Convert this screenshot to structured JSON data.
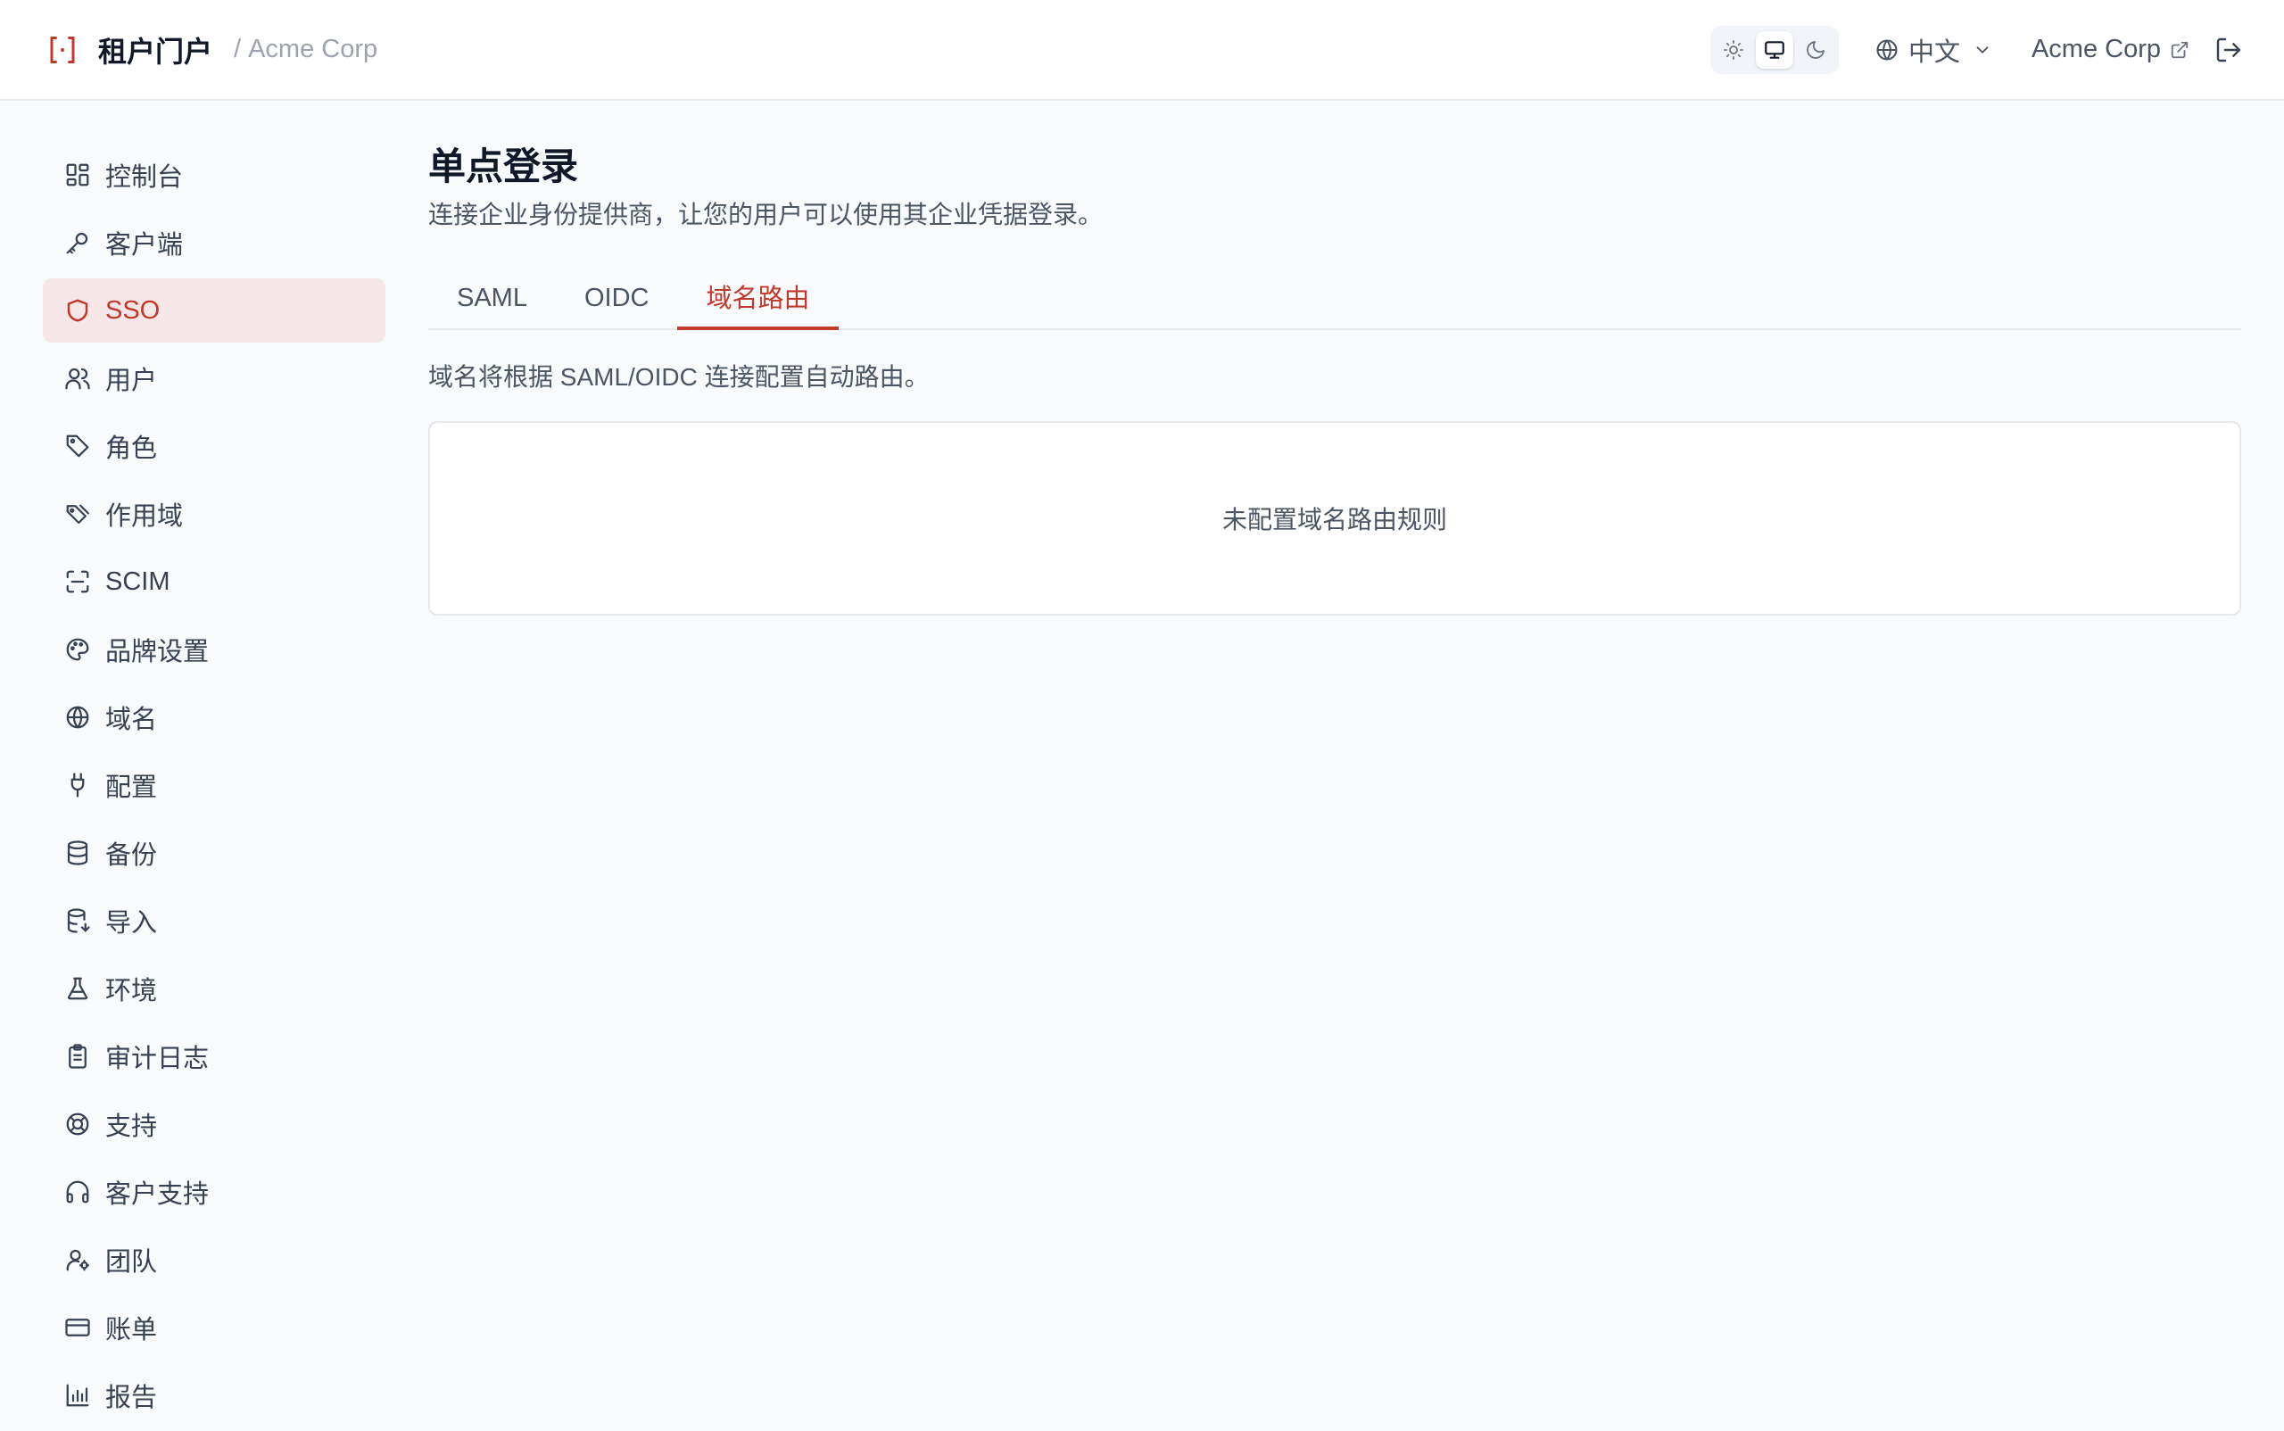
{
  "header": {
    "app_name": "租户门户",
    "separator": "/",
    "tenant": "Acme Corp",
    "theme_options": [
      "light",
      "system",
      "dark"
    ],
    "theme_selected": "system",
    "language": "中文",
    "tenant_link": "Acme Corp",
    "accent_color": "#c0392b"
  },
  "sidebar": {
    "items": [
      {
        "label": "控制台",
        "icon": "dashboard-icon"
      },
      {
        "label": "客户端",
        "icon": "key-icon"
      },
      {
        "label": "SSO",
        "icon": "shield-icon",
        "active": true
      },
      {
        "label": "用户",
        "icon": "users-icon"
      },
      {
        "label": "角色",
        "icon": "tag-icon"
      },
      {
        "label": "作用域",
        "icon": "tags-icon"
      },
      {
        "label": "SCIM",
        "icon": "scan-icon"
      },
      {
        "label": "品牌设置",
        "icon": "palette-icon"
      },
      {
        "label": "域名",
        "icon": "globe-icon"
      },
      {
        "label": "配置",
        "icon": "plug-icon"
      },
      {
        "label": "备份",
        "icon": "database-icon"
      },
      {
        "label": "导入",
        "icon": "database-import-icon"
      },
      {
        "label": "环境",
        "icon": "flask-icon"
      },
      {
        "label": "审计日志",
        "icon": "clipboard-icon"
      },
      {
        "label": "支持",
        "icon": "lifebuoy-icon"
      },
      {
        "label": "客户支持",
        "icon": "headphones-icon"
      },
      {
        "label": "团队",
        "icon": "user-cog-icon"
      },
      {
        "label": "账单",
        "icon": "credit-card-icon"
      },
      {
        "label": "报告",
        "icon": "bar-chart-icon"
      }
    ]
  },
  "main": {
    "title": "单点登录",
    "description": "连接企业身份提供商，让您的用户可以使用其企业凭据登录。",
    "tabs": [
      {
        "label": "SAML"
      },
      {
        "label": "OIDC"
      },
      {
        "label": "域名路由",
        "active": true
      }
    ],
    "tab_info": "域名将根据 SAML/OIDC 连接配置自动路由。",
    "empty_text": "未配置域名路由规则"
  }
}
